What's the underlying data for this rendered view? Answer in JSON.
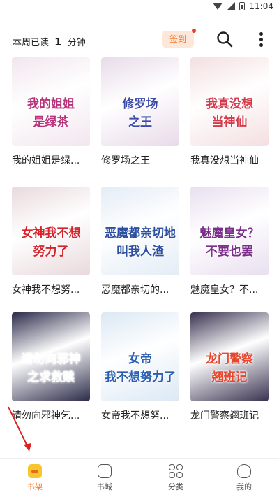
{
  "status_bar": {
    "time": "11:04"
  },
  "header": {
    "read_prefix": "本周已读",
    "read_minutes": "1",
    "read_suffix": "分钟",
    "checkin_label": "签到"
  },
  "books": [
    {
      "title": "我的姐姐是绿...",
      "cover_text1": "我的姐姐",
      "cover_text2": "是绿茶",
      "color": "#f2e6ee",
      "accent": "#b8317a"
    },
    {
      "title": "修罗场之王",
      "cover_text1": "修罗场",
      "cover_text2": "之王",
      "color": "#e8dbe9",
      "accent": "#3b4aa8"
    },
    {
      "title": "我真没想当神仙",
      "cover_text1": "我真没想",
      "cover_text2": "当神仙",
      "color": "#f4dfe0",
      "accent": "#d43a4a"
    },
    {
      "title": "女神我不想努...",
      "cover_text1": "女神我不想",
      "cover_text2": "努力了",
      "color": "#e9d9dc",
      "accent": "#d7232b"
    },
    {
      "title": "恶魔都亲切的...",
      "cover_text1": "恶魔都亲切地",
      "cover_text2": "叫我人渣",
      "color": "#e3ecf6",
      "accent": "#2d4fa0"
    },
    {
      "title": "魅魔皇女？不...",
      "cover_text1": "魅魔皇女？",
      "cover_text2": "不要也罢",
      "color": "#e9dff0",
      "accent": "#7b2f8a"
    },
    {
      "title": "请勿向邪神乞...",
      "cover_text1": "请勿向邪神",
      "cover_text2": "之求救赎",
      "color": "#2b2b4a",
      "accent": "#ffffff"
    },
    {
      "title": "女帝我不想努...",
      "cover_text1": "女帝",
      "cover_text2": "我不想努力了",
      "color": "#dbe8f4",
      "accent": "#2a5fb0"
    },
    {
      "title": "龙门警察翘班记",
      "cover_text1": "龙门警察",
      "cover_text2": "翘班记",
      "color": "#3a3350",
      "accent": "#e7472f"
    }
  ],
  "tabs": [
    {
      "label": "书架"
    },
    {
      "label": "书城"
    },
    {
      "label": "分类"
    },
    {
      "label": "我的"
    }
  ],
  "colors": {
    "accent": "#f47c2f"
  }
}
